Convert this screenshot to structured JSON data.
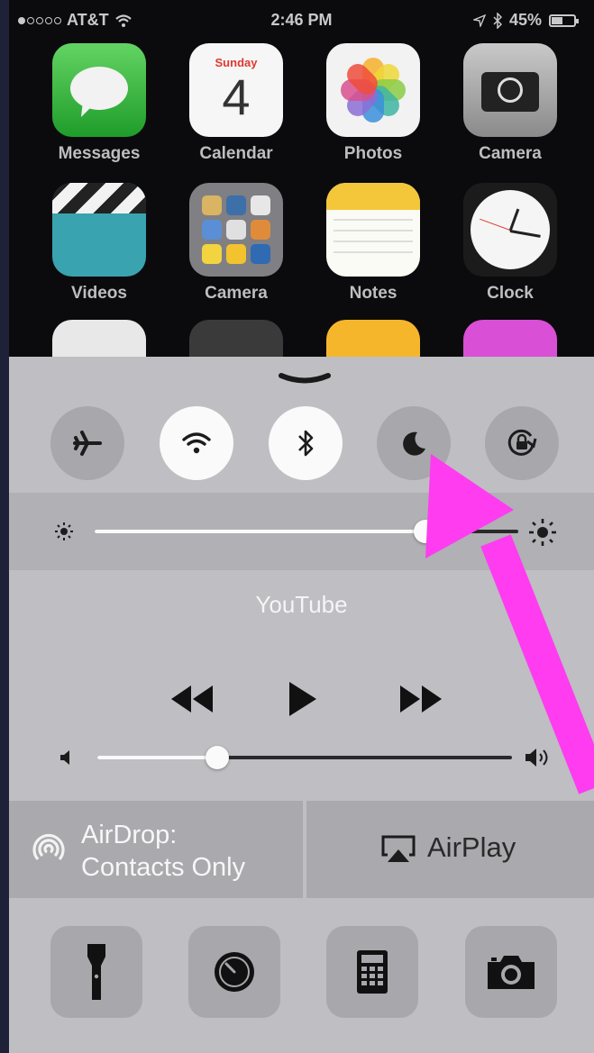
{
  "status_bar": {
    "carrier": "AT&T",
    "time": "2:46 PM",
    "battery": "45%",
    "signal_bars_filled": 1,
    "battery_level": 0.45
  },
  "home_screen": {
    "apps": [
      {
        "label": "Messages",
        "icon": "messages-icon"
      },
      {
        "label": "Calendar",
        "icon": "calendar-icon",
        "weekday": "Sunday",
        "date": "4"
      },
      {
        "label": "Photos",
        "icon": "photos-icon"
      },
      {
        "label": "Camera",
        "icon": "camera-icon"
      },
      {
        "label": "Videos",
        "icon": "videos-icon"
      },
      {
        "label": "Camera",
        "icon": "folder-icon"
      },
      {
        "label": "Notes",
        "icon": "notes-icon"
      },
      {
        "label": "Clock",
        "icon": "clock-icon"
      }
    ]
  },
  "control_center": {
    "toggles": [
      {
        "name": "airplane-mode",
        "icon": "airplane-icon",
        "on": false
      },
      {
        "name": "wifi",
        "icon": "wifi-icon",
        "on": true
      },
      {
        "name": "bluetooth",
        "icon": "bluetooth-icon",
        "on": true
      },
      {
        "name": "do-not-disturb",
        "icon": "moon-icon",
        "on": false
      },
      {
        "name": "rotation-lock",
        "icon": "rotation-lock-icon",
        "on": false
      }
    ],
    "brightness_level": 0.78,
    "now_playing": {
      "app": "YouTube"
    },
    "volume_level": 0.29,
    "airdrop": {
      "line1": "AirDrop:",
      "line2": "Contacts Only"
    },
    "airplay": {
      "label": "AirPlay"
    },
    "shortcuts": [
      "flashlight-icon",
      "timer-icon",
      "calculator-icon",
      "camera-icon"
    ]
  },
  "annotation": {
    "color": "#ff3cf0",
    "points_to": "do-not-disturb"
  }
}
